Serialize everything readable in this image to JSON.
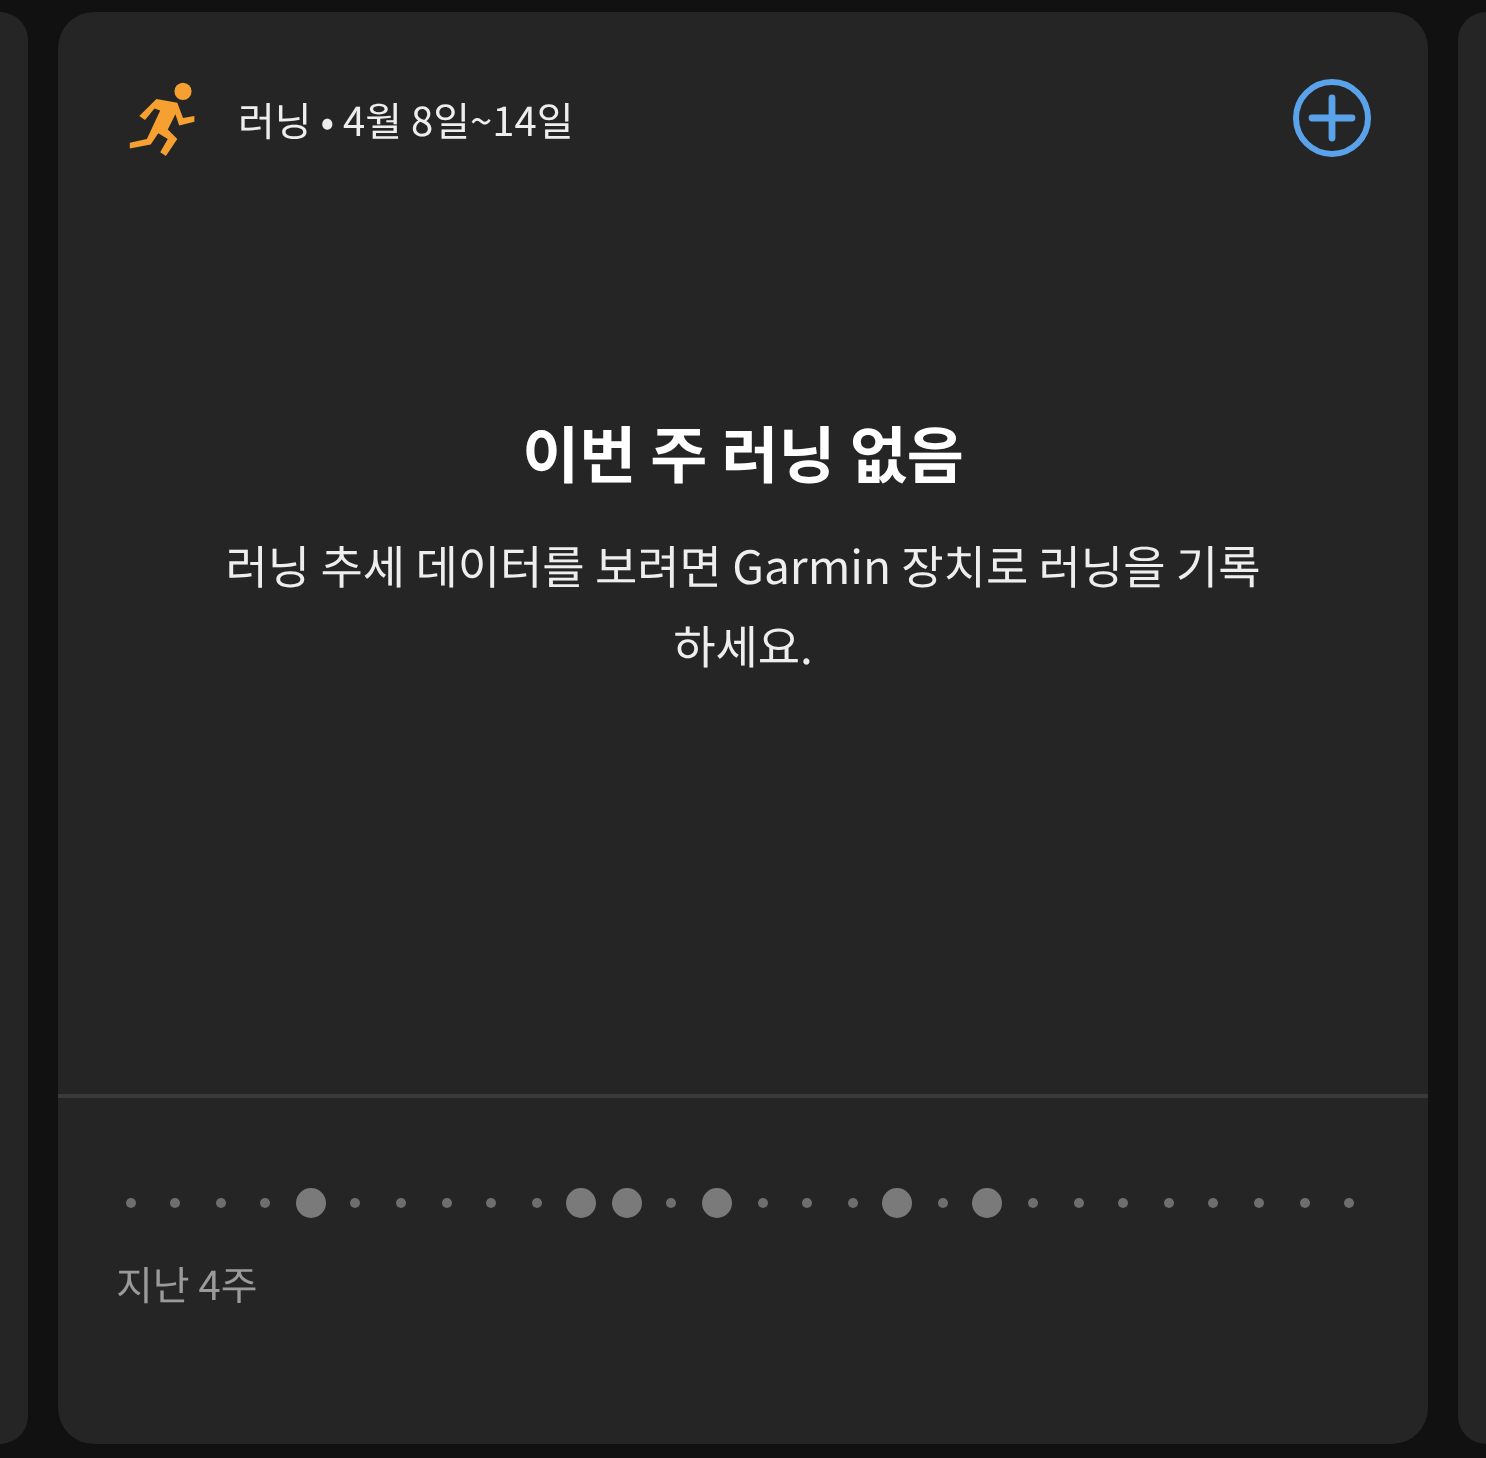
{
  "card": {
    "title": "러닝 • 4월 8일~14일",
    "empty_title": "이번 주 러닝 없음",
    "empty_message": "러닝 추세 데이터를 보려면 Garmin 장치로 러닝을 기록하세요.",
    "period_label": "지난 4주",
    "days": [
      {
        "active": false
      },
      {
        "active": false
      },
      {
        "active": false
      },
      {
        "active": false
      },
      {
        "active": true
      },
      {
        "active": false
      },
      {
        "active": false
      },
      {
        "active": false
      },
      {
        "active": false
      },
      {
        "active": false
      },
      {
        "active": true
      },
      {
        "active": true
      },
      {
        "active": false
      },
      {
        "active": true
      },
      {
        "active": false
      },
      {
        "active": false
      },
      {
        "active": false
      },
      {
        "active": true
      },
      {
        "active": false
      },
      {
        "active": true
      },
      {
        "active": false
      },
      {
        "active": false
      },
      {
        "active": false
      },
      {
        "active": false
      },
      {
        "active": false
      },
      {
        "active": false
      },
      {
        "active": false
      },
      {
        "active": false
      }
    ]
  }
}
